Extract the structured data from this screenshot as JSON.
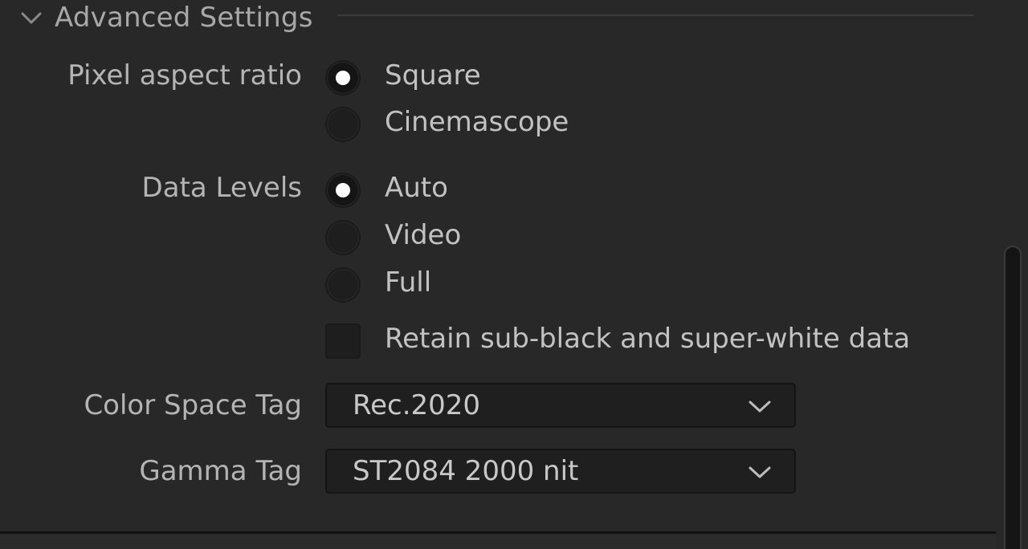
{
  "section": {
    "title": "Advanced Settings",
    "expanded": true,
    "icon": "chevron-down-icon"
  },
  "pixel_aspect_ratio": {
    "label": "Pixel aspect ratio",
    "options": [
      {
        "label": "Square",
        "selected": true
      },
      {
        "label": "Cinemascope",
        "selected": false
      }
    ]
  },
  "data_levels": {
    "label": "Data Levels",
    "options": [
      {
        "label": "Auto",
        "selected": true
      },
      {
        "label": "Video",
        "selected": false
      },
      {
        "label": "Full",
        "selected": false
      }
    ]
  },
  "retain_checkbox": {
    "label": "Retain sub-black and super-white data",
    "checked": false
  },
  "color_space_tag": {
    "label": "Color Space Tag",
    "value": "Rec.2020"
  },
  "gamma_tag": {
    "label": "Gamma Tag",
    "value": "ST2084 2000 nit"
  },
  "colors": {
    "background": "#282828",
    "label_text": "#b4b4b4",
    "field_background": "#1f1f1f",
    "radio_dot": "#ffffff"
  }
}
